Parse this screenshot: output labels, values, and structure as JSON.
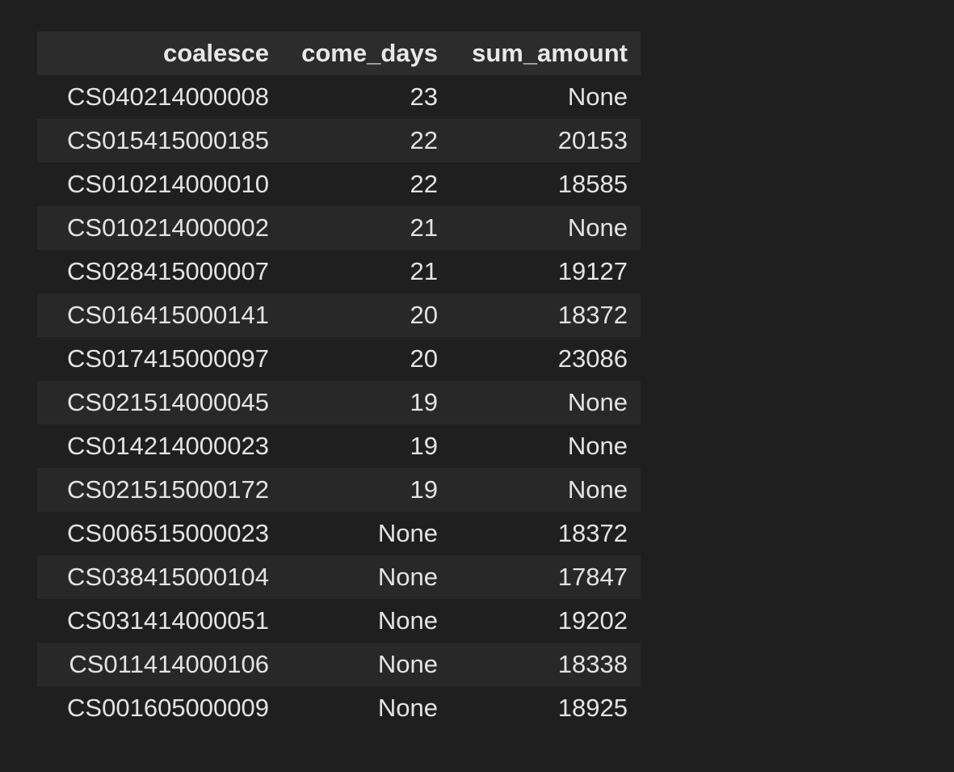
{
  "table": {
    "columns": [
      "coalesce",
      "come_days",
      "sum_amount"
    ],
    "rows": [
      [
        "CS040214000008",
        "23",
        "None"
      ],
      [
        "CS015415000185",
        "22",
        "20153"
      ],
      [
        "CS010214000010",
        "22",
        "18585"
      ],
      [
        "CS010214000002",
        "21",
        "None"
      ],
      [
        "CS028415000007",
        "21",
        "19127"
      ],
      [
        "CS016415000141",
        "20",
        "18372"
      ],
      [
        "CS017415000097",
        "20",
        "23086"
      ],
      [
        "CS021514000045",
        "19",
        "None"
      ],
      [
        "CS014214000023",
        "19",
        "None"
      ],
      [
        "CS021515000172",
        "19",
        "None"
      ],
      [
        "CS006515000023",
        "None",
        "18372"
      ],
      [
        "CS038415000104",
        "None",
        "17847"
      ],
      [
        "CS031414000051",
        "None",
        "19202"
      ],
      [
        "CS011414000106",
        "None",
        "18338"
      ],
      [
        "CS001605000009",
        "None",
        "18925"
      ]
    ]
  }
}
